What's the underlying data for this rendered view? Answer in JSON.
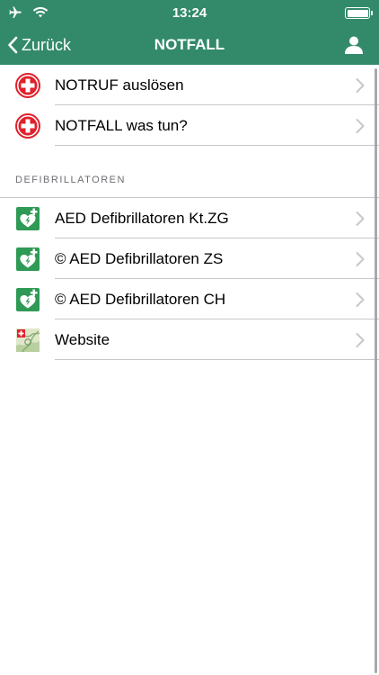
{
  "status": {
    "time": "13:24",
    "icons": [
      "airplane-icon",
      "wifi-icon",
      "battery-icon"
    ]
  },
  "nav": {
    "back_label": "Zurück",
    "title": "NOTFALL",
    "right_icon": "user-icon"
  },
  "colors": {
    "nav_bg": "#338a6b",
    "aed_green": "#2e9a55",
    "red_cross": "#e0202b"
  },
  "emergency": {
    "items": [
      {
        "label": "NOTRUF auslösen",
        "icon": "red-cross-icon"
      },
      {
        "label": "NOTFALL was tun?",
        "icon": "red-cross-icon"
      }
    ]
  },
  "defib": {
    "header": "DEFIBRILLATOREN",
    "items": [
      {
        "label": "AED Defibrillatoren Kt.ZG",
        "icon": "aed-icon"
      },
      {
        "label": "© AED Defibrillatoren ZS",
        "icon": "aed-icon"
      },
      {
        "label": "© AED Defibrillatoren CH",
        "icon": "aed-icon"
      },
      {
        "label": "Website",
        "icon": "map-icon"
      }
    ]
  }
}
